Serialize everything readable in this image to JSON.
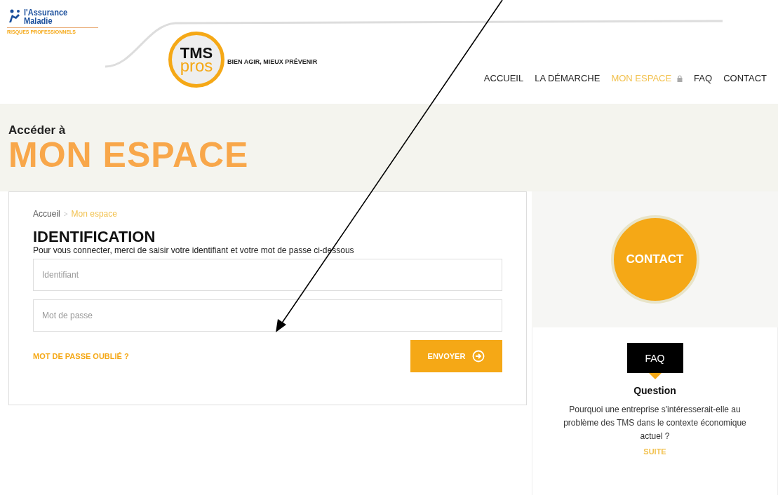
{
  "header": {
    "org_logo": {
      "line1": "l'Assurance",
      "line2": "Maladie",
      "tagline": "RISQUES PROFESSIONNELS"
    },
    "brand": {
      "top": "TMS",
      "bottom": "pros",
      "slogan": "BIEN AGIR, MIEUX PRÉVENIR"
    },
    "nav": [
      {
        "label": "ACCUEIL",
        "selected": false,
        "locked": false
      },
      {
        "label": "LA DÉMARCHE",
        "selected": false,
        "locked": false
      },
      {
        "label": "MON ESPACE",
        "selected": true,
        "locked": true
      },
      {
        "label": "FAQ",
        "selected": false,
        "locked": false
      },
      {
        "label": "CONTACT",
        "selected": false,
        "locked": false
      }
    ]
  },
  "hero": {
    "kicker": "Accéder à",
    "title": "MON ESPACE"
  },
  "breadcrumb_separator": ">",
  "breadcrumb": [
    {
      "label": "Accueil",
      "selected": false
    },
    {
      "label": "Mon espace",
      "selected": true
    }
  ],
  "form": {
    "title": "IDENTIFICATION",
    "intro": "Pour vous connecter, merci de saisir votre identifiant et votre mot de passe ci-dessous",
    "fields": [
      {
        "placeholder": "Identifiant"
      },
      {
        "placeholder": "Mot de passe"
      }
    ],
    "forgot_link": "MOT DE PASSE OUBLIÉ ?",
    "submit": "ENVOYER"
  },
  "sidebar": {
    "contact_button": "CONTACT",
    "faq": {
      "badge": "FAQ",
      "title": "Question",
      "text": "Pourquoi une entreprise s'intéresserait-elle au problème des TMS dans le contexte économique actuel ?",
      "link": "SUITE"
    }
  },
  "annotation": {
    "kind": "arrow"
  }
}
